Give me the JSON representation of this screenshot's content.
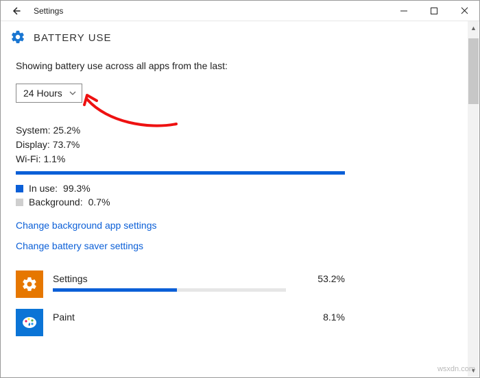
{
  "window": {
    "title": "Settings"
  },
  "header": {
    "page_title": "BATTERY USE"
  },
  "content": {
    "description": "Showing battery use across all apps from the last:",
    "dropdown_value": "24 Hours",
    "stats": {
      "system_label": "System:",
      "system_value": "25.2%",
      "display_label": "Display:",
      "display_value": "73.7%",
      "wifi_label": "Wi-Fi:",
      "wifi_value": "1.1%"
    },
    "usage": {
      "in_use_label": "In use:",
      "in_use_value": "99.3%",
      "background_label": "Background:",
      "background_value": "0.7%"
    },
    "links": {
      "change_bg": "Change background app settings",
      "change_saver": "Change battery saver settings"
    },
    "apps": [
      {
        "name": "Settings",
        "percent": "53.2%",
        "percent_num": 53.2
      },
      {
        "name": "Paint",
        "percent": "8.1%",
        "percent_num": 8.1
      }
    ]
  },
  "watermark": "wsxdn.com"
}
